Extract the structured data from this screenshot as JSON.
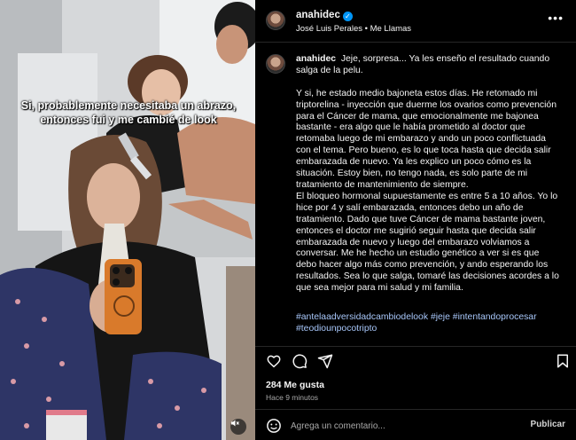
{
  "media": {
    "caption": "Si, probablemente necesitaba un abrazo, entonces fui y me cambié de look",
    "mute_icon": "speaker-muted-icon"
  },
  "header": {
    "username": "anahidec",
    "audio": "José Luis Perales • Me Llamas",
    "more_icon": "more-horizontal-icon",
    "verified_icon": "verified-badge-icon"
  },
  "comment": {
    "username": "anahidec",
    "text": "Jeje, sorpresa... Ya les enseño el resultado cuando salga de la pelu.\n\nY si, he estado medio bajoneta estos días. He retomado mi triptorelina - inyección que duerme los ovarios como prevención para el Cáncer de mama, que emocionalmente me bajonea bastante - era algo que le había prometido al doctor que retomaba luego de mi embarazo y ando un poco conflictuada con el tema. Pero bueno, es lo que toca hasta que decida salir embarazada de nuevo. Ya les explico un poco cómo es la situación. Estoy bien, no tengo nada, es solo parte de mi tratamiento de mantenimiento de siempre.\nEl bloqueo hormonal supuestamente es entre 5 a 10 años. Yo lo hice por 4 y salí embarazada, entonces debo un año de tratamiento. Dado que tuve Cáncer de mama bastante joven, entonces el doctor me sugirió seguir hasta que decida salir embarazada de nuevo y luego del embarazo volviamos a conversar. Me he hecho un estudio genético a ver si es que debo hacer algo más como prevención, y ando esperando los resultados. Sea lo que salga, tomaré las decisiones acordes a lo que sea mejor para mi salud y mi familia.",
    "hashtags": [
      "#antelaadversidadcambiodelook",
      "#jeje",
      "#intentandoprocesar",
      "#teodiounpocotripto"
    ]
  },
  "actions": {
    "likes": "284 Me gusta",
    "time": "Hace 9 minutos",
    "comment_placeholder": "Agrega un comentario...",
    "post_label": "Publicar"
  }
}
